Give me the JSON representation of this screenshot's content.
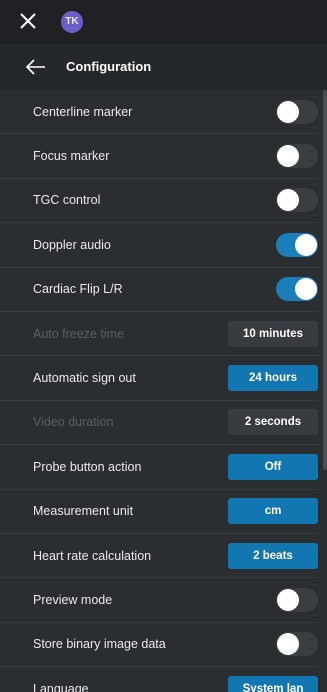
{
  "topbar": {
    "close_icon": "close-icon",
    "avatar_initials": "TK",
    "avatar_color": "#6c5fc7"
  },
  "header": {
    "back_icon": "arrow-left-icon",
    "title": "Configuration"
  },
  "colors": {
    "accent": "#1a7fb8",
    "background": "#2b2e31",
    "disabled_text": "#5b5f63"
  },
  "settings": [
    {
      "label": "Centerline marker",
      "type": "toggle",
      "on": false,
      "enabled": true
    },
    {
      "label": "Focus marker",
      "type": "toggle",
      "on": false,
      "enabled": true
    },
    {
      "label": "TGC control",
      "type": "toggle",
      "on": false,
      "enabled": true
    },
    {
      "label": "Doppler audio",
      "type": "toggle",
      "on": true,
      "enabled": true
    },
    {
      "label": "Cardiac Flip L/R",
      "type": "toggle",
      "on": true,
      "enabled": true
    },
    {
      "label": "Auto freeze time",
      "type": "value",
      "value": "10 minutes",
      "enabled": false
    },
    {
      "label": "Automatic sign out",
      "type": "value",
      "value": "24 hours",
      "enabled": true
    },
    {
      "label": "Video duration",
      "type": "value",
      "value": "2 seconds",
      "enabled": false
    },
    {
      "label": "Probe button action",
      "type": "value",
      "value": "Off",
      "enabled": true
    },
    {
      "label": "Measurement unit",
      "type": "value",
      "value": "cm",
      "enabled": true
    },
    {
      "label": "Heart rate calculation",
      "type": "value",
      "value": "2 beats",
      "enabled": true
    },
    {
      "label": "Preview mode",
      "type": "toggle",
      "on": false,
      "enabled": true
    },
    {
      "label": "Store binary image data",
      "type": "toggle",
      "on": false,
      "enabled": true
    },
    {
      "label": "Language",
      "type": "value",
      "value": "System lan",
      "enabled": true
    }
  ]
}
